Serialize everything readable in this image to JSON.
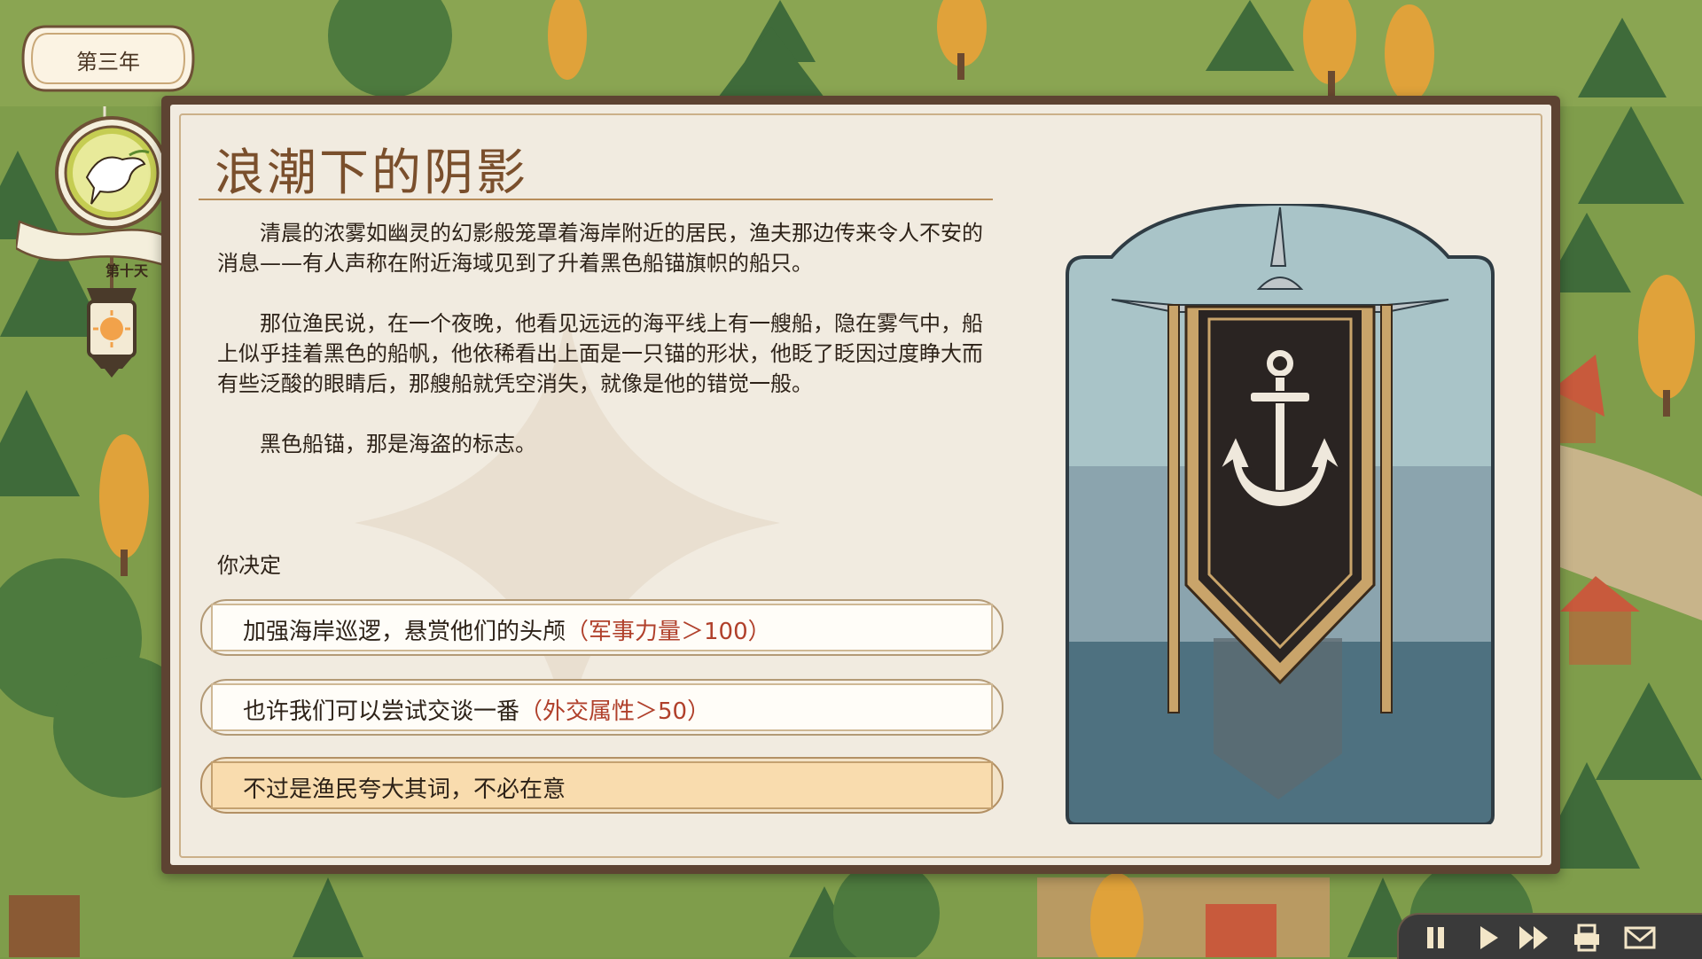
{
  "hud": {
    "year_label": "第三年",
    "day_label": "第十天"
  },
  "event": {
    "title": "浪潮下的阴影",
    "paragraphs": [
      "清晨的浓雾如幽灵的幻影般笼罩着海岸附近的居民，渔夫那边传来令人不安的消息——有人声称在附近海域见到了升着黑色船锚旗帜的船只。",
      "那位渔民说，在一个夜晚，他看见远远的海平线上有一艘船，隐在雾气中，船上似乎挂着黑色的船帆，他依稀看出上面是一只锚的形状，他眨了眨因过度睁大而有些泛酸的眼睛后，那艘船就凭空消失，就像是他的错觉一般。",
      "黑色船锚，那是海盗的标志。"
    ],
    "prompt": "你决定",
    "choices": [
      {
        "text": "加强海岸巡逻，悬赏他们的头颅",
        "requirement": "（军事力量＞100）",
        "selected": false
      },
      {
        "text": "也许我们可以尝试交谈一番",
        "requirement": "（外交属性＞50）",
        "selected": false
      },
      {
        "text": "不过是渔民夸大其词，不必在意",
        "requirement": "",
        "selected": true
      }
    ],
    "illustration_icon": "black-anchor-banner-icon"
  },
  "controls": [
    {
      "name": "pause-icon"
    },
    {
      "name": "play-icon"
    },
    {
      "name": "fast-forward-icon"
    },
    {
      "name": "printer-icon"
    },
    {
      "name": "mail-icon"
    }
  ],
  "colors": {
    "dialog_frame": "#5d4332",
    "paper": "#f1ebe0",
    "title": "#7a4f2c",
    "requirement_text": "#b0402b",
    "selected_choice": "#f9dcae",
    "banner_black": "#2a2422",
    "banner_gold": "#c9a46a",
    "sea_light": "#a9c4c8",
    "sea_dark": "#4e7180"
  }
}
